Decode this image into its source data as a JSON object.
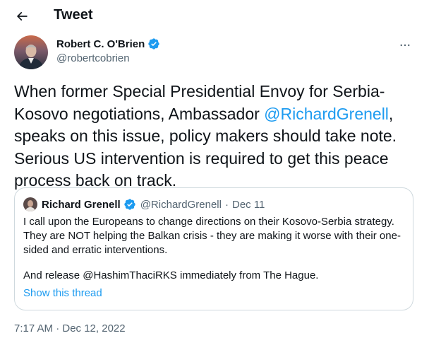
{
  "header": {
    "title": "Tweet",
    "back_icon": "arrow-left-icon"
  },
  "tweet": {
    "author": {
      "name": "Robert C. O'Brien",
      "handle": "@robertcobrien",
      "verified": true
    },
    "text": {
      "part1": "When former Special Presidential Envoy for Serbia-Kosovo negotiations, Ambassador ",
      "mention": "@RichardGrenell",
      "part2": ", speaks on this issue, policy makers should take note. Serious US intervention is required to get this peace process back on track."
    },
    "quoted": {
      "name": "Richard Grenell",
      "verified": true,
      "handle": "@RichardGrenell",
      "separator": "·",
      "date": "Dec 11",
      "paragraph1": "I call upon the Europeans to change directions on their Kosovo-Serbia strategy. They are NOT helping the Balkan crisis - they are making it worse with their one-sided and erratic interventions.",
      "paragraph2": "And release @HashimThaciRKS immediately from The Hague.",
      "show_thread": "Show this thread"
    },
    "timestamp": "7:17 AM · Dec 12, 2022"
  },
  "colors": {
    "accent": "#1d9bf0",
    "text": "#0f1419",
    "muted": "#536471",
    "border": "#cfd9de"
  }
}
